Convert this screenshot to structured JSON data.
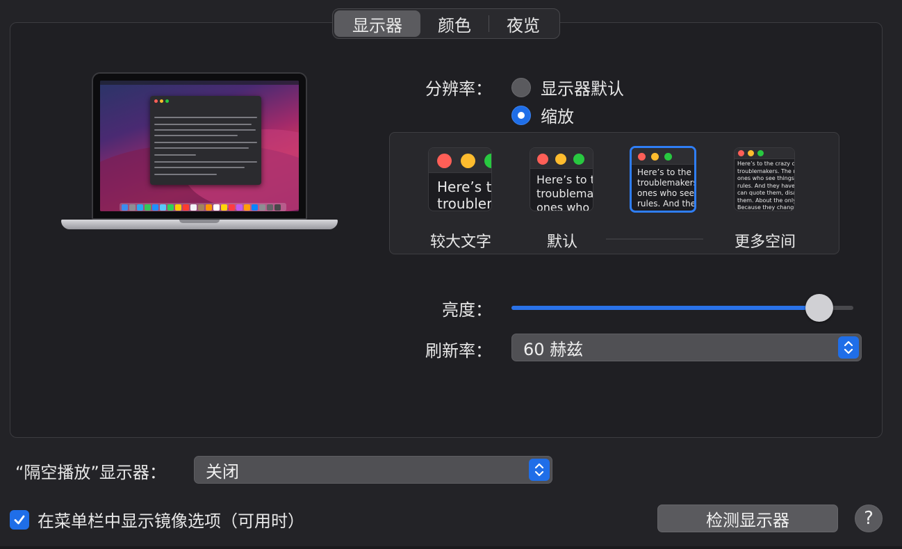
{
  "tabs": [
    {
      "label": "显示器",
      "selected": true
    },
    {
      "label": "颜色",
      "selected": false
    },
    {
      "label": "夜览",
      "selected": false
    }
  ],
  "resolution": {
    "label": "分辨率：",
    "options": [
      {
        "label": "显示器默认",
        "selected": false
      },
      {
        "label": "缩放",
        "selected": true
      }
    ]
  },
  "scale_options": [
    {
      "caption": "较大文字",
      "preview_text": "Here’s to\ntroublem",
      "selected": false
    },
    {
      "caption": "默认",
      "preview_text": "Here’s to t\ntroublema\nones who",
      "selected": false
    },
    {
      "caption": "",
      "preview_text": "Here’s to the cr\ntroublemakers.\nones who see t\nrules. And they",
      "selected": true
    },
    {
      "caption": "更多空间",
      "preview_text": "Here’s to the crazy one\ntroublemakers. The rou\nones who see things dif\nrules. And they have no\ncan quote them, disagre\nthem. About the only th\nBecause they change th",
      "selected": false
    }
  ],
  "brightness": {
    "label": "亮度：",
    "value": 0.9
  },
  "refresh_rate": {
    "label": "刷新率：",
    "value": "60 赫兹"
  },
  "airplay": {
    "label": "“隔空播放”显示器：",
    "value": "关闭"
  },
  "mirror_option": {
    "label": "在菜单栏中显示镜像选项（可用时）",
    "checked": true
  },
  "detect_button": {
    "label": "检测显示器"
  },
  "help_button": {
    "label": "?"
  },
  "colors": {
    "accent": "#1f6ee8",
    "traffic_red": "#ff5f57",
    "traffic_yellow": "#febc2e",
    "traffic_green": "#28c840"
  }
}
